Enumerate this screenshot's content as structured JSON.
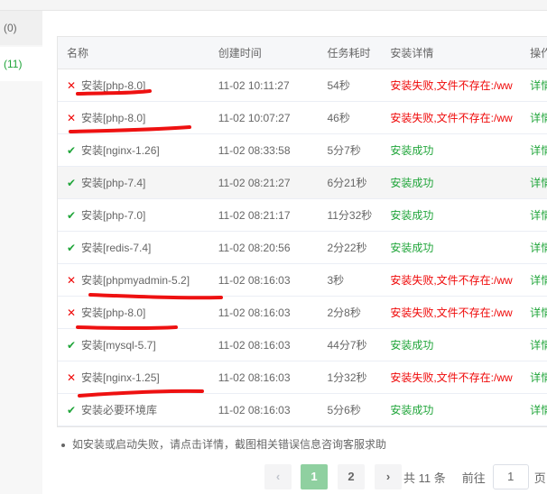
{
  "sidebar": {
    "items": [
      {
        "label": "(0)"
      },
      {
        "label": "(11)"
      }
    ]
  },
  "table": {
    "headers": {
      "name": "名称",
      "time": "创建时间",
      "duration": "任务耗时",
      "detail": "安装详情",
      "op": "操作"
    },
    "rows": [
      {
        "status": "fail",
        "name": "安装[php-8.0]",
        "time": "11-02 10:11:27",
        "duration": "54秒",
        "detail": "安装失败,文件不存在:/ww",
        "op": "详情"
      },
      {
        "status": "fail",
        "name": "安装[php-8.0]",
        "time": "11-02 10:07:27",
        "duration": "46秒",
        "detail": "安装失败,文件不存在:/ww",
        "op": "详情"
      },
      {
        "status": "ok",
        "name": "安装[nginx-1.26]",
        "time": "11-02 08:33:58",
        "duration": "5分7秒",
        "detail": "安装成功",
        "op": "详情"
      },
      {
        "status": "ok",
        "name": "安装[php-7.4]",
        "time": "11-02 08:21:27",
        "duration": "6分21秒",
        "detail": "安装成功",
        "op": "详情"
      },
      {
        "status": "ok",
        "name": "安装[php-7.0]",
        "time": "11-02 08:21:17",
        "duration": "11分32秒",
        "detail": "安装成功",
        "op": "详情"
      },
      {
        "status": "ok",
        "name": "安装[redis-7.4]",
        "time": "11-02 08:20:56",
        "duration": "2分22秒",
        "detail": "安装成功",
        "op": "详情"
      },
      {
        "status": "fail",
        "name": "安装[phpmyadmin-5.2]",
        "time": "11-02 08:16:03",
        "duration": "3秒",
        "detail": "安装失败,文件不存在:/ww",
        "op": "详情"
      },
      {
        "status": "fail",
        "name": "安装[php-8.0]",
        "time": "11-02 08:16:03",
        "duration": "2分8秒",
        "detail": "安装失败,文件不存在:/ww",
        "op": "详情"
      },
      {
        "status": "ok",
        "name": "安装[mysql-5.7]",
        "time": "11-02 08:16:03",
        "duration": "44分7秒",
        "detail": "安装成功",
        "op": "详情"
      },
      {
        "status": "fail",
        "name": "安装[nginx-1.25]",
        "time": "11-02 08:16:03",
        "duration": "1分32秒",
        "detail": "安装失败,文件不存在:/ww",
        "op": "详情"
      },
      {
        "status": "ok",
        "name": "安装必要环境库",
        "time": "11-02 08:16:03",
        "duration": "5分6秒",
        "detail": "安装成功",
        "op": "详情"
      }
    ]
  },
  "note": "如安装或启动失败，请点击详情，截图相关错误信息咨询客服求助",
  "pagination": {
    "prev_icon": "chevron-left",
    "pages": [
      "1",
      "2"
    ],
    "current": "1",
    "next_icon": "chevron-right",
    "total": "共 11 条",
    "goto_label": "前往",
    "goto_value": "1",
    "page_suffix": "页"
  },
  "colors": {
    "success": "#20a53a",
    "fail": "#ef0808",
    "annotation": "#e11"
  }
}
